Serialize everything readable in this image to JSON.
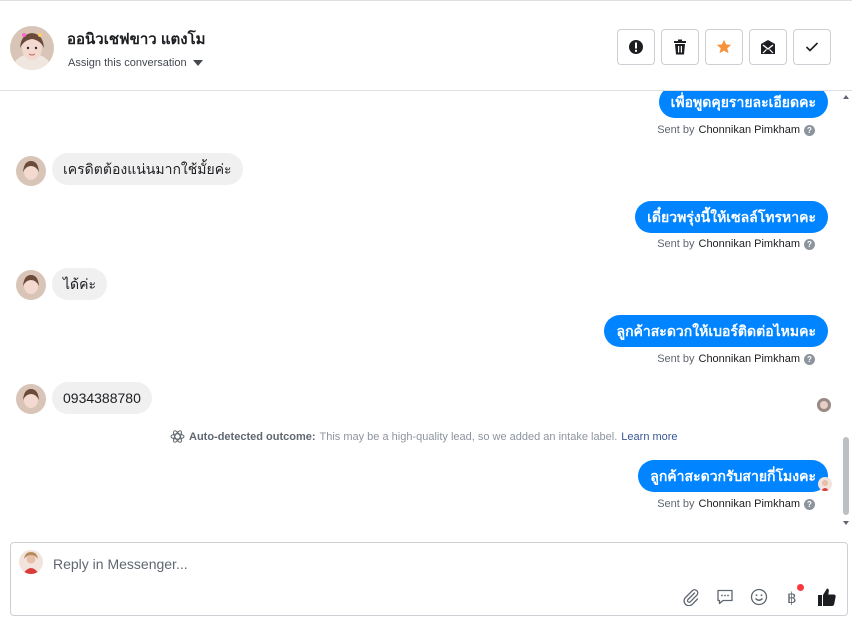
{
  "header": {
    "contact_name": "ออนิวเชฟขาว แตงโม",
    "assign_label": "Assign this conversation",
    "actions": [
      {
        "icon": "alert-icon"
      },
      {
        "icon": "trash-icon"
      },
      {
        "icon": "star-icon",
        "color": "#f7923b"
      },
      {
        "icon": "mark-unread-icon"
      },
      {
        "icon": "checkmark-icon"
      }
    ]
  },
  "thread": {
    "sent_by_prefix": "Sent by",
    "agent_name": "Chonnikan Pimkham",
    "messages": [
      {
        "direction": "outgoing",
        "text": "เพื่อพูดคุยรายละเอียดคะ"
      },
      {
        "direction": "incoming",
        "text": "เครดิตต้องแน่นมากใช้มั้ยค่ะ"
      },
      {
        "direction": "outgoing",
        "text": "เดี๋ยวพรุ่งนี้ให้เซลล์โทรหาคะ"
      },
      {
        "direction": "incoming",
        "text": "ได้ค่ะ"
      },
      {
        "direction": "outgoing",
        "text": "ลูกค้าสะดวกให้เบอร์ติดต่อไหมคะ"
      },
      {
        "direction": "incoming",
        "text": "0934388780"
      },
      {
        "direction": "outgoing",
        "text": "ลูกค้าสะดวกรับสายกี่โมงคะ"
      }
    ],
    "outcome": {
      "label": "Auto-detected outcome:",
      "text": "This may be a high-quality lead, so we added an intake label.",
      "link": "Learn more"
    }
  },
  "composer": {
    "placeholder": "Reply in Messenger...",
    "tools": [
      "paperclip-icon",
      "saved-reply-icon",
      "emoji-icon",
      "baht-payment-icon",
      "thumbs-up-icon"
    ]
  },
  "colors": {
    "accent": "#0084ff",
    "star": "#f7923b",
    "notification": "#fa383e"
  }
}
